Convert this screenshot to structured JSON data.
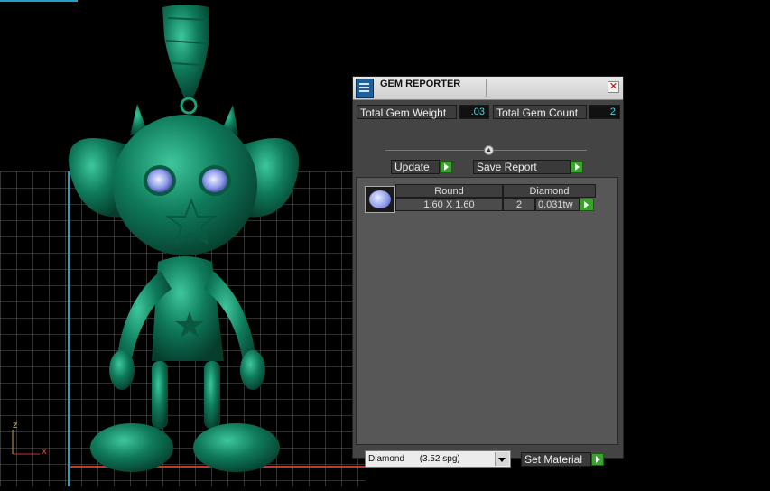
{
  "viewport": {
    "axis_z": "z",
    "axis_x": "x"
  },
  "panel": {
    "title": "GEM REPORTER",
    "close_symbol": "✕",
    "total_gem_weight_label": "Total Gem Weight",
    "total_gem_weight_value": ".03",
    "total_gem_count_label": "Total Gem Count",
    "total_gem_count_value": "2",
    "update_label": "Update",
    "save_report_label": "Save Report",
    "table": {
      "headers": [
        "Round",
        "Diamond"
      ],
      "row": {
        "size": "1.60 X 1.60",
        "count": "2",
        "weight": "0.031tw"
      }
    },
    "material_select": {
      "selected": "Diamond      (3.52 spg)"
    },
    "set_material_label": "Set Material"
  },
  "colors": {
    "model_green": "#0f7a5b",
    "value_cyan": "#4fd2e0",
    "button_green": "#3aa32e",
    "axis_blue": "#1fa2c4",
    "axis_red": "#c0392b"
  }
}
